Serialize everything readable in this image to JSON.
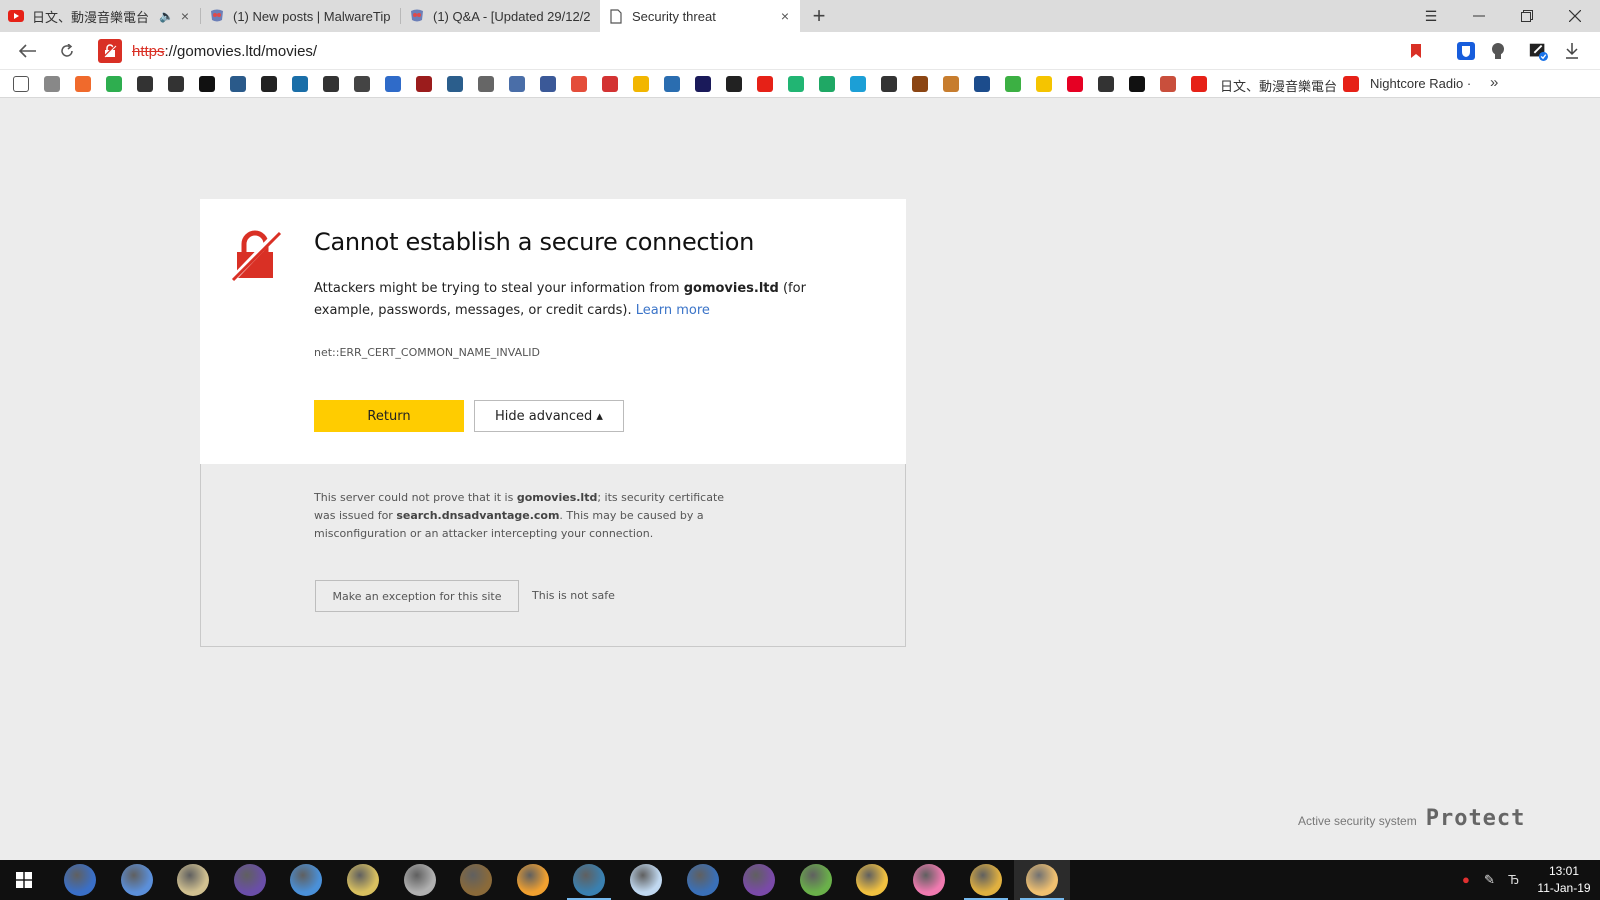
{
  "tabs": [
    {
      "title": "日文、動漫音樂電台",
      "muted": true,
      "favicon": "youtube-icon"
    },
    {
      "title": "(1) New posts | MalwareTips",
      "favicon": "malwaretips-icon"
    },
    {
      "title": "(1) Q&A - [Updated 29/12/2",
      "favicon": "malwaretips-icon"
    },
    {
      "title": "Security threat",
      "favicon": "page-icon",
      "active": true
    }
  ],
  "address_bar": {
    "scheme": "https",
    "rest": "://gomovies.ltd/movies/"
  },
  "bookmarks": {
    "labels": [
      "日文、動漫音樂電台",
      "Nightcore Radio ·"
    ],
    "icon_colors": [
      "#ffffff",
      "#888888",
      "#f06a2c",
      "#2eae4f",
      "#333333",
      "#333333",
      "#111111",
      "#2a5a8a",
      "#222222",
      "#1a6ea8",
      "#333333",
      "#444444",
      "#2f6bc9",
      "#9b1c1c",
      "#2b5e8c",
      "#666666",
      "#4a6ea8",
      "#3b5998",
      "#e44d3a",
      "#d33333",
      "#f2b600",
      "#2a6db0",
      "#1a1a5a",
      "#222222",
      "#e62117",
      "#21b573",
      "#1fa865",
      "#1c9fd6",
      "#333333",
      "#8b4513",
      "#c77d2e",
      "#1c4c8c",
      "#3cb043",
      "#f5c400",
      "#e60023",
      "#333333",
      "#111111",
      "#c94f3c",
      "#e62117"
    ]
  },
  "error": {
    "title": "Cannot establish a secure connection",
    "desc_prefix": "Attackers might be trying to steal your information from ",
    "domain": "gomovies.ltd",
    "desc_suffix": " (for example, passwords, messages, or credit cards).",
    "learn_more": "Learn more",
    "code": "net::ERR_CERT_COMMON_NAME_INVALID",
    "return_label": "Return",
    "hide_advanced_label": "Hide advanced ▴"
  },
  "advanced": {
    "text_1": "This server could not prove that it is ",
    "domain": "gomovies.ltd",
    "text_2": "; its security certificate was issued for ",
    "issued_for": "search.dnsadvantage.com",
    "text_3": ". This may be caused by a misconfiguration or an attacker intercepting your connection.",
    "exception_label": "Make an exception for this site",
    "not_safe": "This is not safe"
  },
  "protect": {
    "label": "Active security system",
    "brand": "Protect"
  },
  "taskbar": {
    "app_colors": [
      "#3a6fc7",
      "#5b8fd9",
      "#d0c090",
      "#6a4ea8",
      "#4a90d8",
      "#d8c060",
      "#b0b0b0",
      "#8a6a3a",
      "#f0a030",
      "#3a80b0",
      "#c0d8f0",
      "#3a70b8",
      "#7a4aa8",
      "#6ab04a",
      "#f0c040",
      "#f07ab0",
      "#e0b040",
      "#f0c070"
    ],
    "time": "13:01",
    "date": "11-Jan-19"
  },
  "colors": {
    "accent_yellow": "#ffcc00",
    "danger_red": "#d93025",
    "link_blue": "#3b74c8"
  }
}
